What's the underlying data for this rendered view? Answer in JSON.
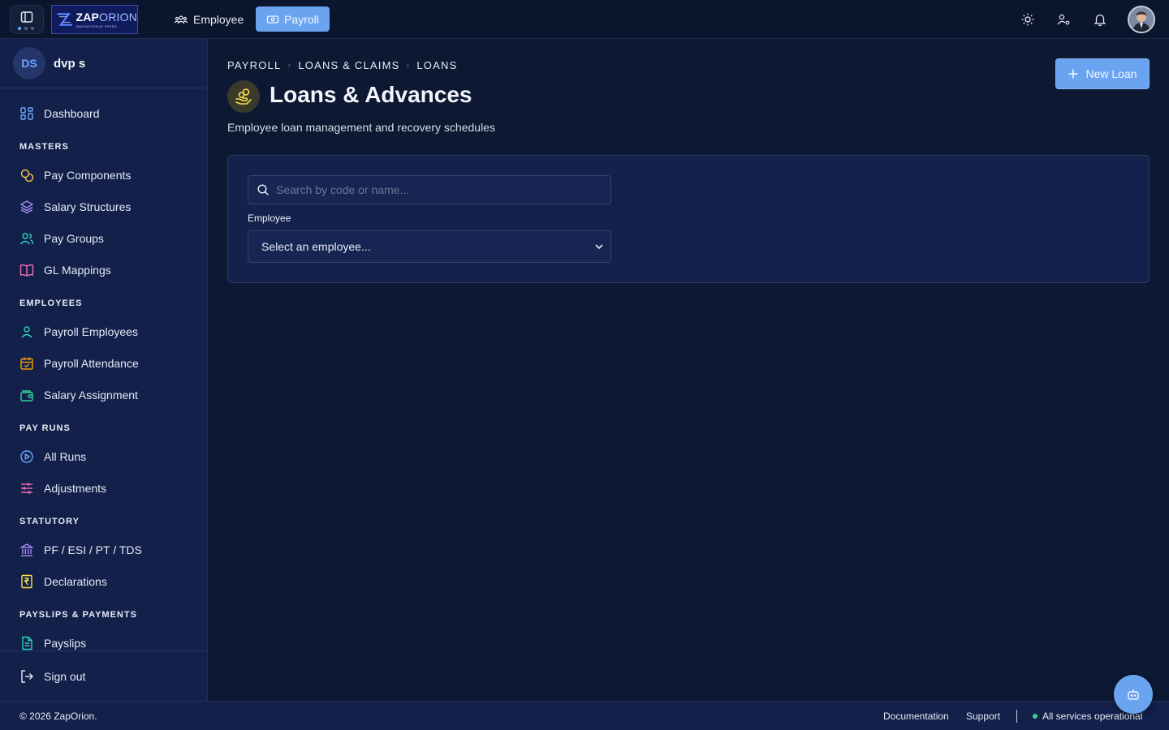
{
  "topbar": {
    "logo_text_bold": "ZAP",
    "logo_text_light": "ORION",
    "logo_tagline": "INNOVATION AT SPEED",
    "nav_employee": "Employee",
    "nav_payroll": "Payroll"
  },
  "sidebar": {
    "user_initials": "DS",
    "user_name": "dvp s",
    "dashboard": "Dashboard",
    "sections": {
      "masters": "MASTERS",
      "employees": "EMPLOYEES",
      "pay_runs": "PAY RUNS",
      "statutory": "STATUTORY",
      "payslips": "PAYSLIPS & PAYMENTS"
    },
    "items": {
      "pay_components": "Pay Components",
      "salary_structures": "Salary Structures",
      "pay_groups": "Pay Groups",
      "gl_mappings": "GL Mappings",
      "payroll_employees": "Payroll Employees",
      "payroll_attendance": "Payroll Attendance",
      "salary_assignment": "Salary Assignment",
      "all_runs": "All Runs",
      "adjustments": "Adjustments",
      "pf_esi": "PF / ESI / PT / TDS",
      "declarations": "Declarations",
      "payslips": "Payslips"
    },
    "sign_out": "Sign out"
  },
  "main": {
    "breadcrumb": [
      "PAYROLL",
      "LOANS & CLAIMS",
      "LOANS"
    ],
    "title": "Loans & Advances",
    "subtitle": "Employee loan management and recovery schedules",
    "new_loan_label": "New Loan",
    "search_placeholder": "Search by code or name...",
    "employee_label": "Employee",
    "employee_select_value": "Select an employee..."
  },
  "footer": {
    "copyright": "© 2026 ZapOrion.",
    "documentation": "Documentation",
    "support": "Support",
    "status": "All services operational"
  },
  "colors": {
    "accent": "#6aa3f0",
    "background": "#0d1832",
    "sidebar": "#12204a",
    "status_ok": "#34d399"
  }
}
